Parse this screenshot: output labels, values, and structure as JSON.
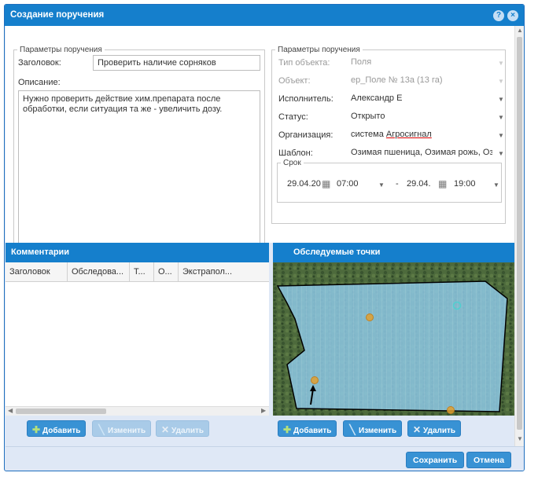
{
  "window": {
    "title": "Создание поручения"
  },
  "left_params": {
    "legend": "Параметры поручения",
    "title_label": "Заголовок:",
    "title_value": "Проверить наличие сорняков",
    "description_label": "Описание:",
    "description_lines": [
      "Нужно проверить действие хим.препарата после",
      "обработки, если ситуация та же - увеличить дозу."
    ]
  },
  "right_params": {
    "legend": "Параметры поручения",
    "object_type_label": "Тип объекта:",
    "object_type_value": "Поля",
    "object_label": "Объект:",
    "object_value": "ер_Поле № 13а (13 га)",
    "executor_label": "Исполнитель:",
    "executor_value": "Александр Е",
    "status_label": "Статус:",
    "status_value": "Открыто",
    "org_label": "Организация:",
    "org_value_prefix": "система ",
    "org_value_underlined": "Агросигнал",
    "template_label": "Шаблон:",
    "template_value": "Озимая пшеница, Озимая рожь, Оз",
    "deadline": {
      "legend": "Срок",
      "start_date": "29.04.20",
      "start_time": "07:00",
      "dash": "-",
      "end_date": "29.04.",
      "end_time": "19:00"
    }
  },
  "comments": {
    "title": "Комментарии",
    "columns": [
      "Заголовок",
      "Обследова...",
      "Т...",
      "О...",
      "Экстрапол..."
    ],
    "buttons": {
      "add": "Добавить",
      "edit": "Изменить",
      "delete": "Удалить"
    }
  },
  "points": {
    "title": "Обследуемые точки",
    "buttons": {
      "add": "Добавить",
      "edit": "Изменить",
      "delete": "Удалить"
    }
  },
  "footer": {
    "save": "Сохранить",
    "cancel": "Отмена"
  },
  "colors": {
    "accent": "#157fcc",
    "field_fill": "#7fc4e8",
    "point_orange": "#e0a030",
    "point_cyan": "#4fd0d0"
  }
}
